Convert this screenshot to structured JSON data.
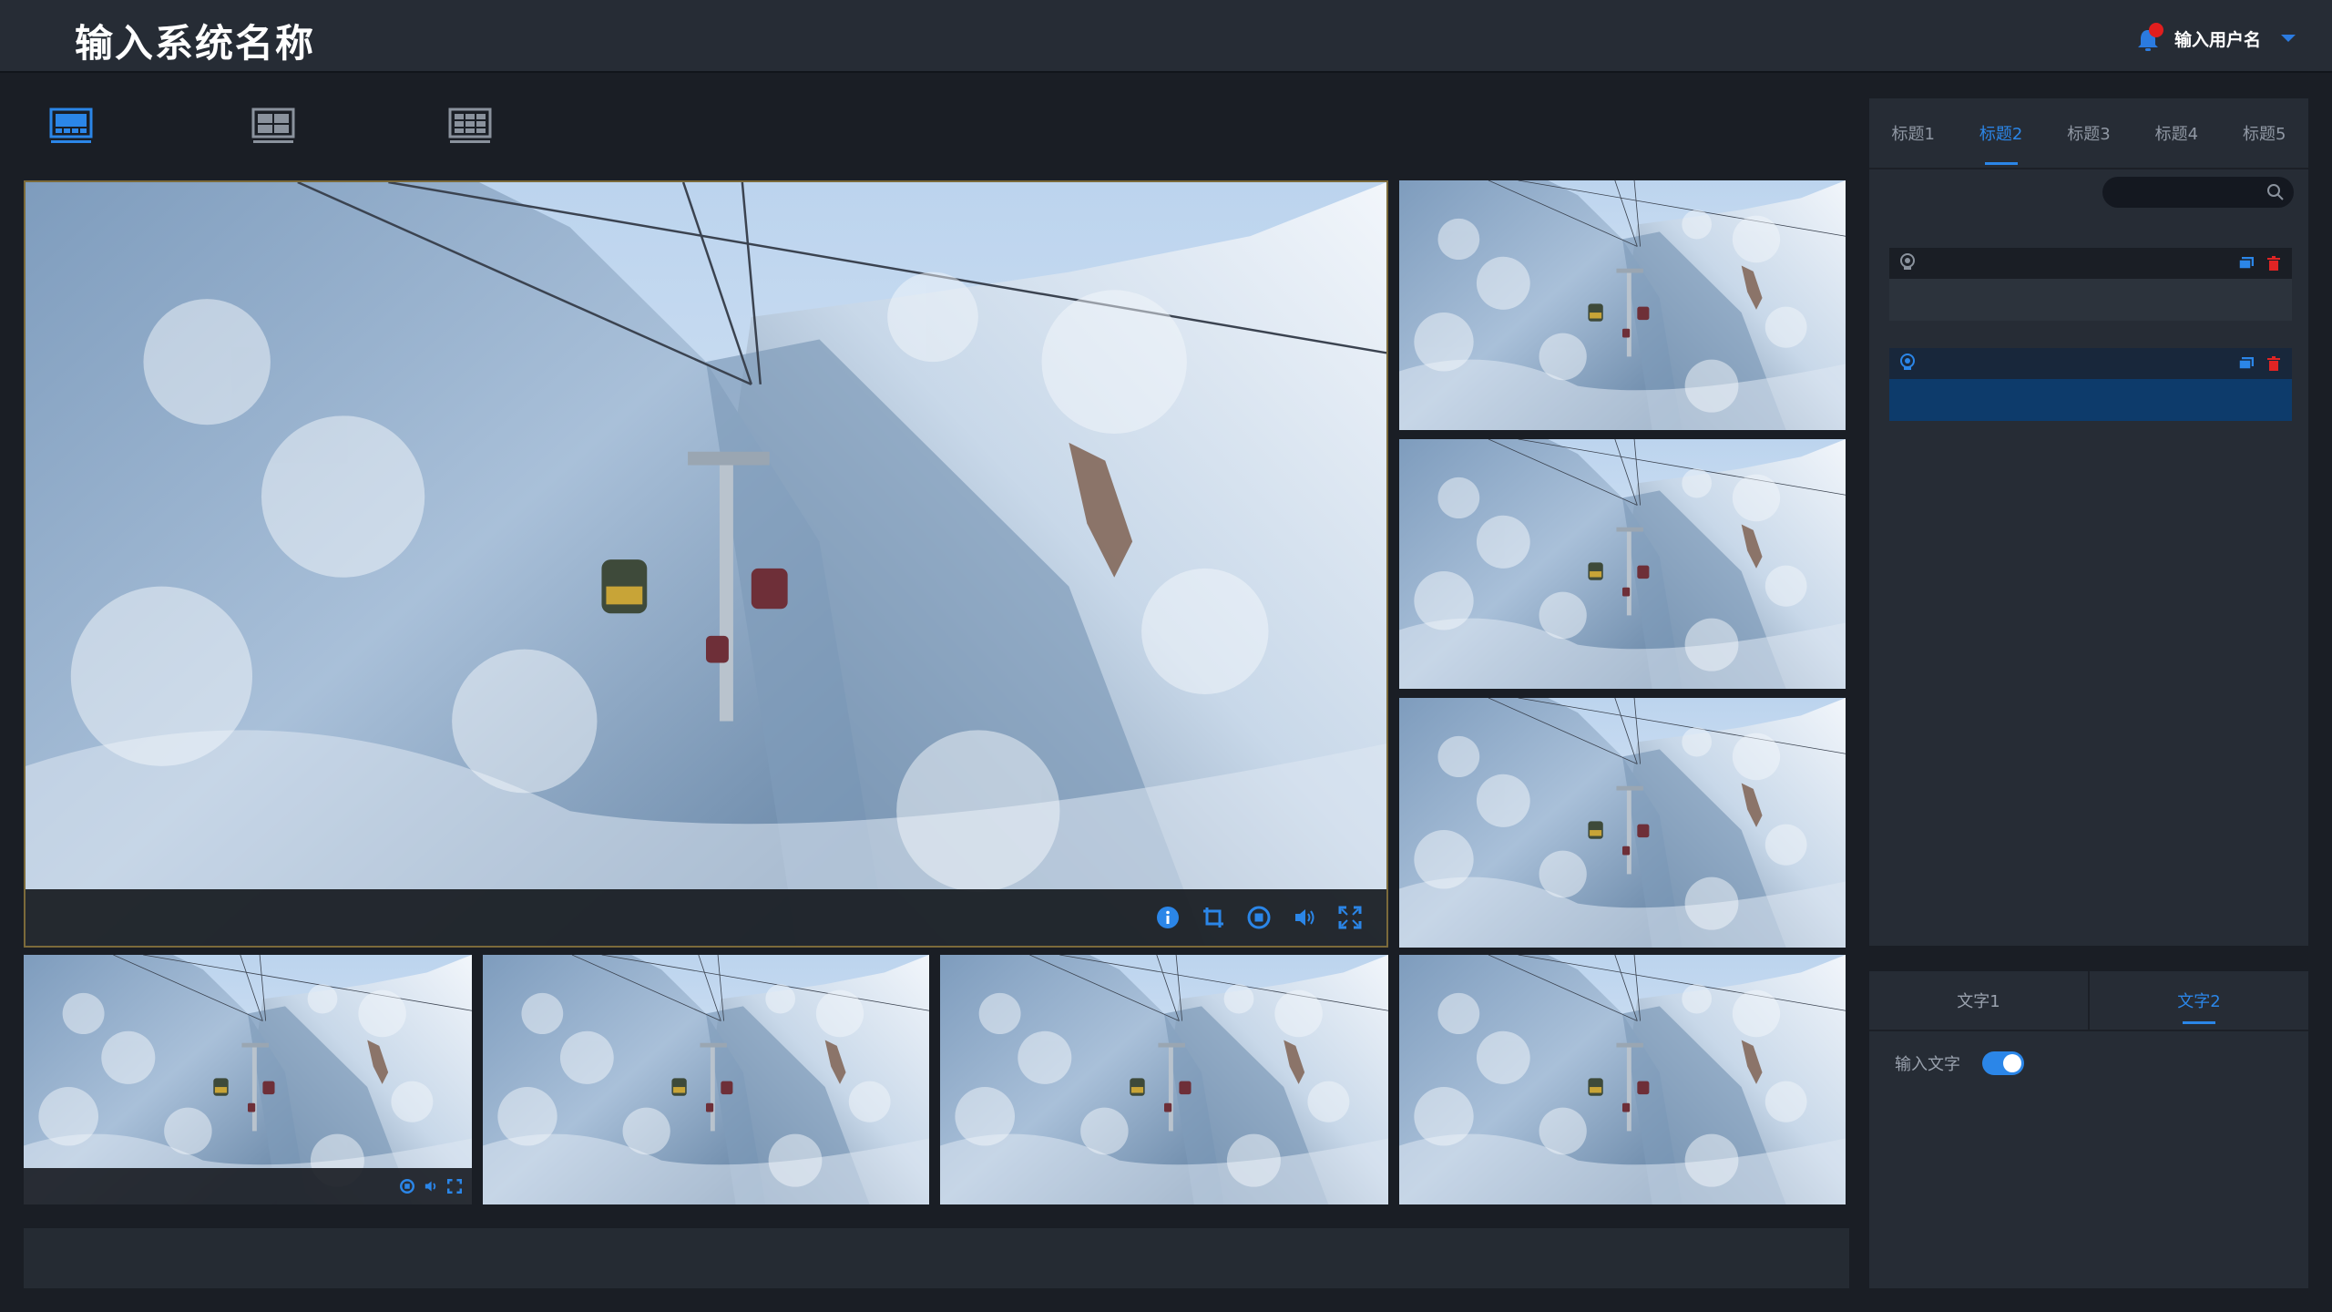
{
  "header": {
    "title": "输入系统名称",
    "username": "输入用户名"
  },
  "layouts": [
    {
      "name": "layout-1-main",
      "active": true
    },
    {
      "name": "layout-4-grid",
      "active": false
    },
    {
      "name": "layout-9-grid",
      "active": false
    }
  ],
  "colors": {
    "accent": "#2b86e8",
    "alert": "#e01e1e",
    "main_border": "#7b6a3a"
  },
  "right_panel": {
    "tabs": [
      {
        "label": "标题1",
        "active": false
      },
      {
        "label": "标题2",
        "active": true
      },
      {
        "label": "标题3",
        "active": false
      },
      {
        "label": "标题4",
        "active": false
      },
      {
        "label": "标题5",
        "active": false
      }
    ],
    "search": {
      "placeholder": ""
    },
    "cameras": [
      {
        "icon": "camera-icon",
        "selected": false
      },
      {
        "icon": "camera-icon",
        "selected": true
      }
    ]
  },
  "bottom_panel": {
    "tabs": [
      {
        "label": "文字1",
        "active": false
      },
      {
        "label": "文字2",
        "active": true
      }
    ],
    "toggle": {
      "label": "输入文字",
      "on": true
    }
  },
  "main_video": {
    "controls": [
      "info-icon",
      "crop-icon",
      "record-icon",
      "volume-icon",
      "fullscreen-icon"
    ]
  }
}
